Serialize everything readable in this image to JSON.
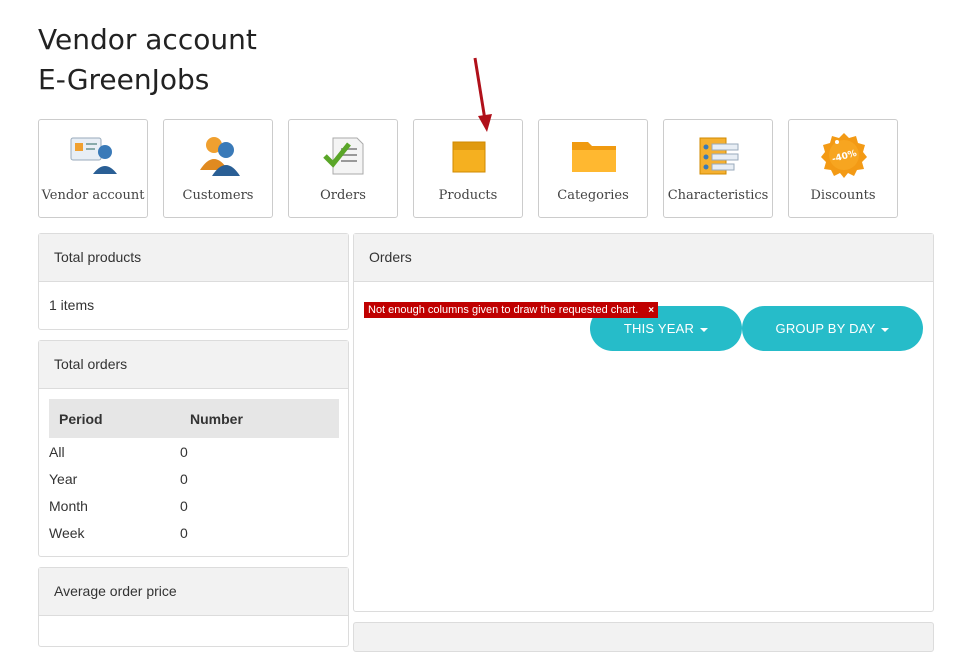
{
  "header": {
    "title_line1": "Vendor account",
    "title_line2": "E-GreenJobs"
  },
  "nav_tiles": [
    {
      "label": "Vendor account",
      "icon": "vendor-card-icon"
    },
    {
      "label": "Customers",
      "icon": "customers-icon"
    },
    {
      "label": "Orders",
      "icon": "orders-checklist-icon"
    },
    {
      "label": "Products",
      "icon": "product-box-icon"
    },
    {
      "label": "Categories",
      "icon": "folder-icon"
    },
    {
      "label": "Characteristics",
      "icon": "characteristics-icon"
    },
    {
      "label": "Discounts",
      "icon": "discount-badge-icon"
    }
  ],
  "discount_badge_text": "-40%",
  "total_products": {
    "title": "Total products",
    "value": "1 items"
  },
  "total_orders": {
    "title": "Total orders",
    "columns": [
      "Period",
      "Number"
    ],
    "rows": [
      {
        "period": "All",
        "number": "0"
      },
      {
        "period": "Year",
        "number": "0"
      },
      {
        "period": "Month",
        "number": "0"
      },
      {
        "period": "Week",
        "number": "0"
      }
    ]
  },
  "average_order_price": {
    "title": "Average order price"
  },
  "orders_panel": {
    "title": "Orders",
    "period_button": "THIS YEAR",
    "group_button": "GROUP BY DAY",
    "error_message": "Not enough columns given to draw the requested chart.",
    "error_close": "×"
  },
  "colors": {
    "accent": "#26bcc9",
    "error": "#c00000",
    "arrow": "#b0101a"
  }
}
